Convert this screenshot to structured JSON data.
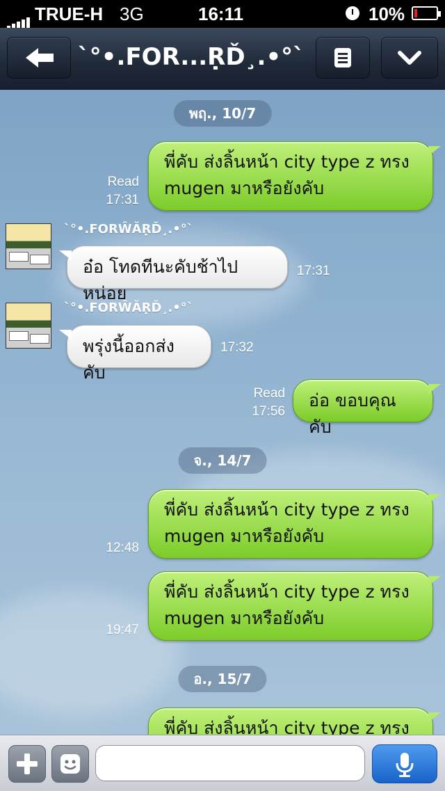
{
  "status_bar": {
    "carrier": "TRUE-H",
    "network": "3G",
    "time": "16:11",
    "battery": "10%",
    "icons": [
      "signal-bars-icon",
      "alarm-clock-icon",
      "battery-low-icon"
    ]
  },
  "header": {
    "title": "`°•.FOR...ṚĎ¸.•°`",
    "back_icon": "left-arrow-icon",
    "menu_icon": "list-icon",
    "more_icon": "chevron-down-icon"
  },
  "chat": {
    "dates": [
      "พฤ., 10/7",
      "จ., 14/7",
      "อ., 15/7"
    ],
    "sender_name": "`°•.FORŴĂṚĎ¸.•°`",
    "messages": [
      {
        "side": "out",
        "line1": "พี่คับ ส่งลิ้นหน้า city type z ทรง",
        "line2": "mugen มาหรือยังคับ",
        "read": "Read",
        "time": "17:31"
      },
      {
        "side": "in",
        "text": "อ๋อ โทดทีนะคับช้าไปหน่อย",
        "time": "17:31"
      },
      {
        "side": "in",
        "text": "พรุ่งนี้ออกส่งคับ",
        "time": "17:32"
      },
      {
        "side": "out",
        "text": "อ่อ ขอบคุณคับ",
        "read": "Read",
        "time": "17:56"
      },
      {
        "side": "out",
        "line1": "พี่คับ ส่งลิ้นหน้า city type z ทรง",
        "line2": "mugen มาหรือยังคับ",
        "time": "12:48"
      },
      {
        "side": "out",
        "line1": "พี่คับ ส่งลิ้นหน้า city type z ทรง",
        "line2": "mugen มาหรือยังคับ",
        "time": "19:47"
      },
      {
        "side": "out",
        "line1": "พี่คับ ส่งลิ้นหน้า city type z ทรง"
      }
    ]
  },
  "toolbar": {
    "add_icon": "plus-icon",
    "emoji_icon": "smiley-icon",
    "message_value": "",
    "mic_icon": "microphone-icon",
    "colors": {
      "send_blue": "#1763c8",
      "bubble_green": "#7ccc2a"
    }
  }
}
